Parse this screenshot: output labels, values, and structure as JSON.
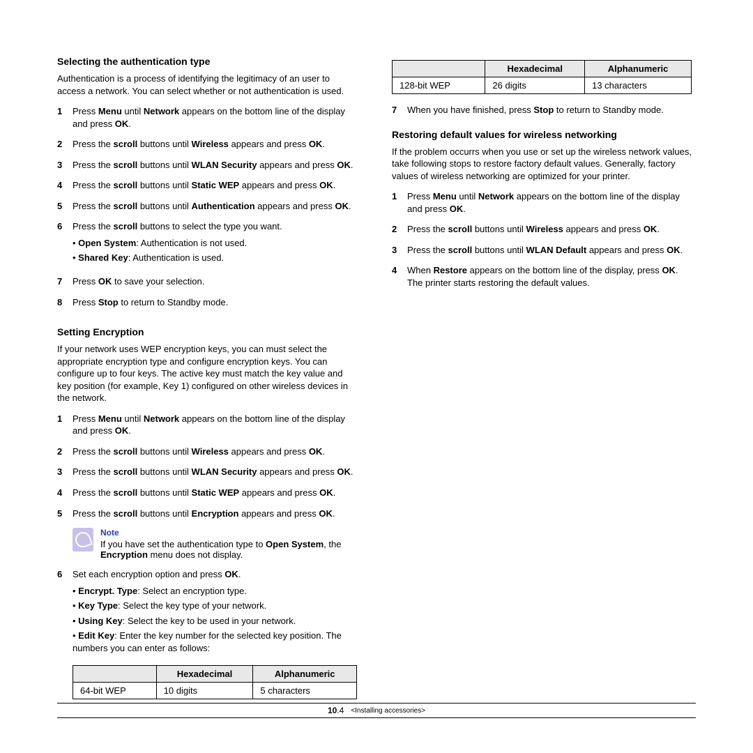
{
  "left": {
    "auth": {
      "title": "Selecting the authentication type",
      "intro": "Authentication is a process of identifying the legitimacy of an user to access a network. You can select whether or not authentication is used.",
      "steps": [
        {
          "n": "1",
          "pre": "Press ",
          "b1": "Menu",
          "mid": " until ",
          "b2": "Network",
          "post": " appears on the bottom line of the display and press ",
          "b3": "OK",
          "end": "."
        },
        {
          "n": "2",
          "pre": "Press the ",
          "b1": "scroll",
          "mid": " buttons until ",
          "b2": "Wireless",
          "post": " appears and press ",
          "b3": "OK",
          "end": "."
        },
        {
          "n": "3",
          "pre": "Press the ",
          "b1": "scroll",
          "mid": " buttons until ",
          "b2": "WLAN Security",
          "post": " appears and press ",
          "b3": "OK",
          "end": "."
        },
        {
          "n": "4",
          "pre": "Press the ",
          "b1": "scroll",
          "mid": " buttons until ",
          "b2": "Static WEP",
          "post": " appears and press ",
          "b3": "OK",
          "end": "."
        },
        {
          "n": "5",
          "pre": "Press the ",
          "b1": "scroll",
          "mid": " buttons until ",
          "b2": "Authentication",
          "post": " appears and press ",
          "b3": "OK",
          "end": "."
        },
        {
          "n": "6",
          "pre": "Press the ",
          "b1": "scroll",
          "mid": " buttons to select the type you want.",
          "b2": "",
          "post": "",
          "b3": "",
          "end": "",
          "subs": [
            {
              "b": "Open System",
              "t": ": Authentication is not used."
            },
            {
              "b": "Shared Key",
              "t": ": Authentication is used."
            }
          ]
        },
        {
          "n": "7",
          "pre": "Press ",
          "b1": "OK",
          "mid": " to save your selection.",
          "b2": "",
          "post": "",
          "b3": "",
          "end": ""
        },
        {
          "n": "8",
          "pre": "Press ",
          "b1": "Stop",
          "mid": " to return to Standby mode.",
          "b2": "",
          "post": "",
          "b3": "",
          "end": ""
        }
      ]
    },
    "enc": {
      "title": "Setting Encryption",
      "intro": "If your network uses WEP encryption keys, you can must select the appropriate encryption type and configure encryption keys. You can configure up to four keys. The active key must match the key value and key position (for example, Key 1) configured on other wireless devices in the network.",
      "steps_a": [
        {
          "n": "1",
          "pre": "Press ",
          "b1": "Menu",
          "mid": " until ",
          "b2": "Network",
          "post": " appears on the bottom line of the display and press ",
          "b3": "OK",
          "end": "."
        },
        {
          "n": "2",
          "pre": "Press the ",
          "b1": "scroll",
          "mid": " buttons until ",
          "b2": "Wireless",
          "post": " appears and press ",
          "b3": "OK",
          "end": "."
        },
        {
          "n": "3",
          "pre": "Press the ",
          "b1": "scroll",
          "mid": " buttons until ",
          "b2": "WLAN Security",
          "post": " appears and press ",
          "b3": "OK",
          "end": "."
        },
        {
          "n": "4",
          "pre": "Press the ",
          "b1": "scroll",
          "mid": " buttons until ",
          "b2": "Static WEP",
          "post": " appears and press ",
          "b3": "OK",
          "end": "."
        },
        {
          "n": "5",
          "pre": "Press the ",
          "b1": "scroll",
          "mid": " buttons until ",
          "b2": "Encryption",
          "post": " appears and press ",
          "b3": "OK",
          "end": "."
        }
      ],
      "note": {
        "title": "Note",
        "pre": "If you have set the authentication type to ",
        "b1": "Open System",
        "mid": ", the ",
        "b2": "Encryption",
        "post": " menu does not display."
      },
      "step6": {
        "n": "6",
        "pre": "Set each encryption option and press ",
        "b1": "OK",
        "end": ".",
        "subs": [
          {
            "b": "Encrypt. Type",
            "t": ": Select an encryption type."
          },
          {
            "b": "Key Type",
            "t": ": Select the key type of your network."
          },
          {
            "b": "Using Key",
            "t": ": Select the key to be used in your network."
          },
          {
            "b": "Edit Key",
            "t": ": Enter the key number for the selected key position. The numbers you can enter as follows:"
          }
        ]
      },
      "table": {
        "h1": "Hexadecimal",
        "h2": "Alphanumeric",
        "row_label": "64-bit WEP",
        "c1": "10 digits",
        "c2": "5 characters"
      }
    }
  },
  "right": {
    "table": {
      "h1": "Hexadecimal",
      "h2": "Alphanumeric",
      "row_label": "128-bit WEP",
      "c1": "26 digits",
      "c2": "13 characters"
    },
    "step7": {
      "n": "7",
      "pre": "When you have finished, press ",
      "b1": "Stop",
      "mid": " to return to Standby mode.",
      "b2": "",
      "post": "",
      "b3": "",
      "end": ""
    },
    "restore": {
      "title": "Restoring default values for wireless networking",
      "intro": "If the problem occurrs when you use or set up the wireless network values, take following stops to restore factory default values. Generally, factory values of wireless networking are optimized for your printer.",
      "steps": [
        {
          "n": "1",
          "pre": "Press ",
          "b1": "Menu",
          "mid": " until ",
          "b2": "Network",
          "post": " appears on the bottom line of the display and press ",
          "b3": "OK",
          "end": "."
        },
        {
          "n": "2",
          "pre": "Press the ",
          "b1": "scroll",
          "mid": " buttons until ",
          "b2": "Wireless",
          "post": " appears and press ",
          "b3": "OK",
          "end": "."
        },
        {
          "n": "3",
          "pre": "Press the ",
          "b1": "scroll",
          "mid": " buttons until ",
          "b2": "WLAN Default",
          "post": " appears and press ",
          "b3": "OK",
          "end": "."
        },
        {
          "n": "4",
          "pre": "When ",
          "b1": "Restore",
          "mid": " appears on the bottom line of the display, press ",
          "b2": "OK",
          "post": ". The printer starts restoring the default values.",
          "b3": "",
          "end": ""
        }
      ]
    }
  },
  "footer": {
    "page_bold": "10",
    "page_sub": ".4",
    "label": "<Installing accessories>"
  }
}
